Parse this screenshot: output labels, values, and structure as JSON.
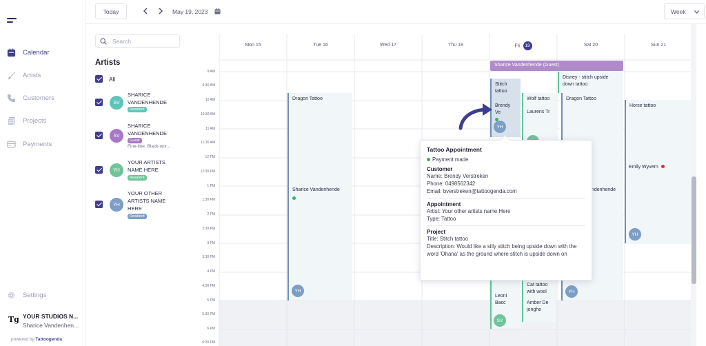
{
  "sidebar": {
    "nav": [
      {
        "label": "Calendar",
        "icon": "calendar-icon",
        "active": true
      },
      {
        "label": "Artists",
        "icon": "brush-icon"
      },
      {
        "label": "Customers",
        "icon": "phone-icon"
      },
      {
        "label": "Projects",
        "icon": "document-icon"
      },
      {
        "label": "Payments",
        "icon": "card-icon"
      }
    ],
    "settings_label": "Settings",
    "studio_name": "YOUR STUDIOS N...",
    "user_name": "Sharice Vandenhen...",
    "logo_text": "Tg",
    "powered_prefix": "powered by",
    "powered_brand": "Tattoogenda"
  },
  "toolbar": {
    "today_label": "Today",
    "date": "May 19, 2023",
    "view_label": "Week"
  },
  "artists_panel": {
    "search_placeholder": "Search",
    "title": "Artists",
    "all_label": "All",
    "artists": [
      {
        "initials": "SV",
        "name": "SHARICE VANDENHENDE",
        "badge": "Resident",
        "color": "#5ec4b8"
      },
      {
        "initials": "SV",
        "name": "SHARICE VANDENHENDE",
        "badge": "Guest",
        "note": "Fine-line; Black-wor...",
        "color": "#a678c6"
      },
      {
        "initials": "YH",
        "name": "YOUR ARTISTS NAME HERE",
        "badge": "Resident",
        "color": "#6fc49a"
      },
      {
        "initials": "YH",
        "name": "YOUR OTHER ARTISTS NAME HERE",
        "badge": "Resident",
        "color": "#7c9ec6"
      }
    ]
  },
  "calendar": {
    "days": [
      {
        "label": "Mon 15"
      },
      {
        "label": "Tue 16"
      },
      {
        "label": "Wed 17"
      },
      {
        "label": "Thu 18"
      },
      {
        "label": "Fri",
        "today_num": "19"
      },
      {
        "label": "Sat 20"
      },
      {
        "label": "Sun 21"
      }
    ],
    "times": [
      "9 AM",
      "9:30 AM",
      "10 AM",
      "10:30 AM",
      "11 AM",
      "11:30 AM",
      "12 PM",
      "12:30 PM",
      "1 PM",
      "1:30 PM",
      "2 PM",
      "2:30 PM",
      "3 PM",
      "3:30 PM",
      "4 PM",
      "4:30 PM",
      "5 PM",
      "5:30 PM",
      "6 PM",
      "6:30 PM"
    ],
    "guest_banner": "Sharice Vandenhende (Guest)",
    "events": {
      "tue_dragon": "Dragon Tattoo",
      "tue_sharice": "Sharice Vandenhende",
      "tue_avatar": "YH",
      "fri_stitch": "Stitch tattoo",
      "fri_brendy": "Brendy Ve",
      "fri_avatar1": "YH",
      "fri_wolf": "Wolf tattoo",
      "fri_laurens": "Laurens Tr",
      "fri_leoni": "Leoni Bacc",
      "fri_avatar2": "SV",
      "fri_cat": "Cat tattoo with wool",
      "fri_amber": "Amber De jonghe",
      "sat_disney": "Disney - stitch upside down tattoo",
      "sat_dragon": "Dragon Tattoo",
      "sat_partial": "ndenhende",
      "sat_avatar": "YH",
      "sun_horse": "Horse tattoo",
      "sun_emily": "Emily Wyvern",
      "sun_avatar": "YH"
    }
  },
  "popover": {
    "title": "Tattoo Appointment",
    "payment_status": "Payment made",
    "customer_heading": "Customer",
    "customer_name": "Name: Brendy Verstreken",
    "customer_phone": "Phone: 0498562342",
    "customer_email": "Email: bverstreken@tattoogenda.com",
    "appointment_heading": "Appointment",
    "appointment_artist": "Artist: Your other artists name Here",
    "appointment_type": "Type: Tattoo",
    "project_heading": "Project",
    "project_title": "Title: Stitch tattoo",
    "project_description": "Description: Would like a silly stitch being upside down with the word 'Ohana' as the ground where stitch is upside down on"
  },
  "colors": {
    "accent": "#3f3d8f",
    "payment_green": "#33b36b",
    "alert_red": "#e03030",
    "guest_purple": "#b08bc9"
  }
}
